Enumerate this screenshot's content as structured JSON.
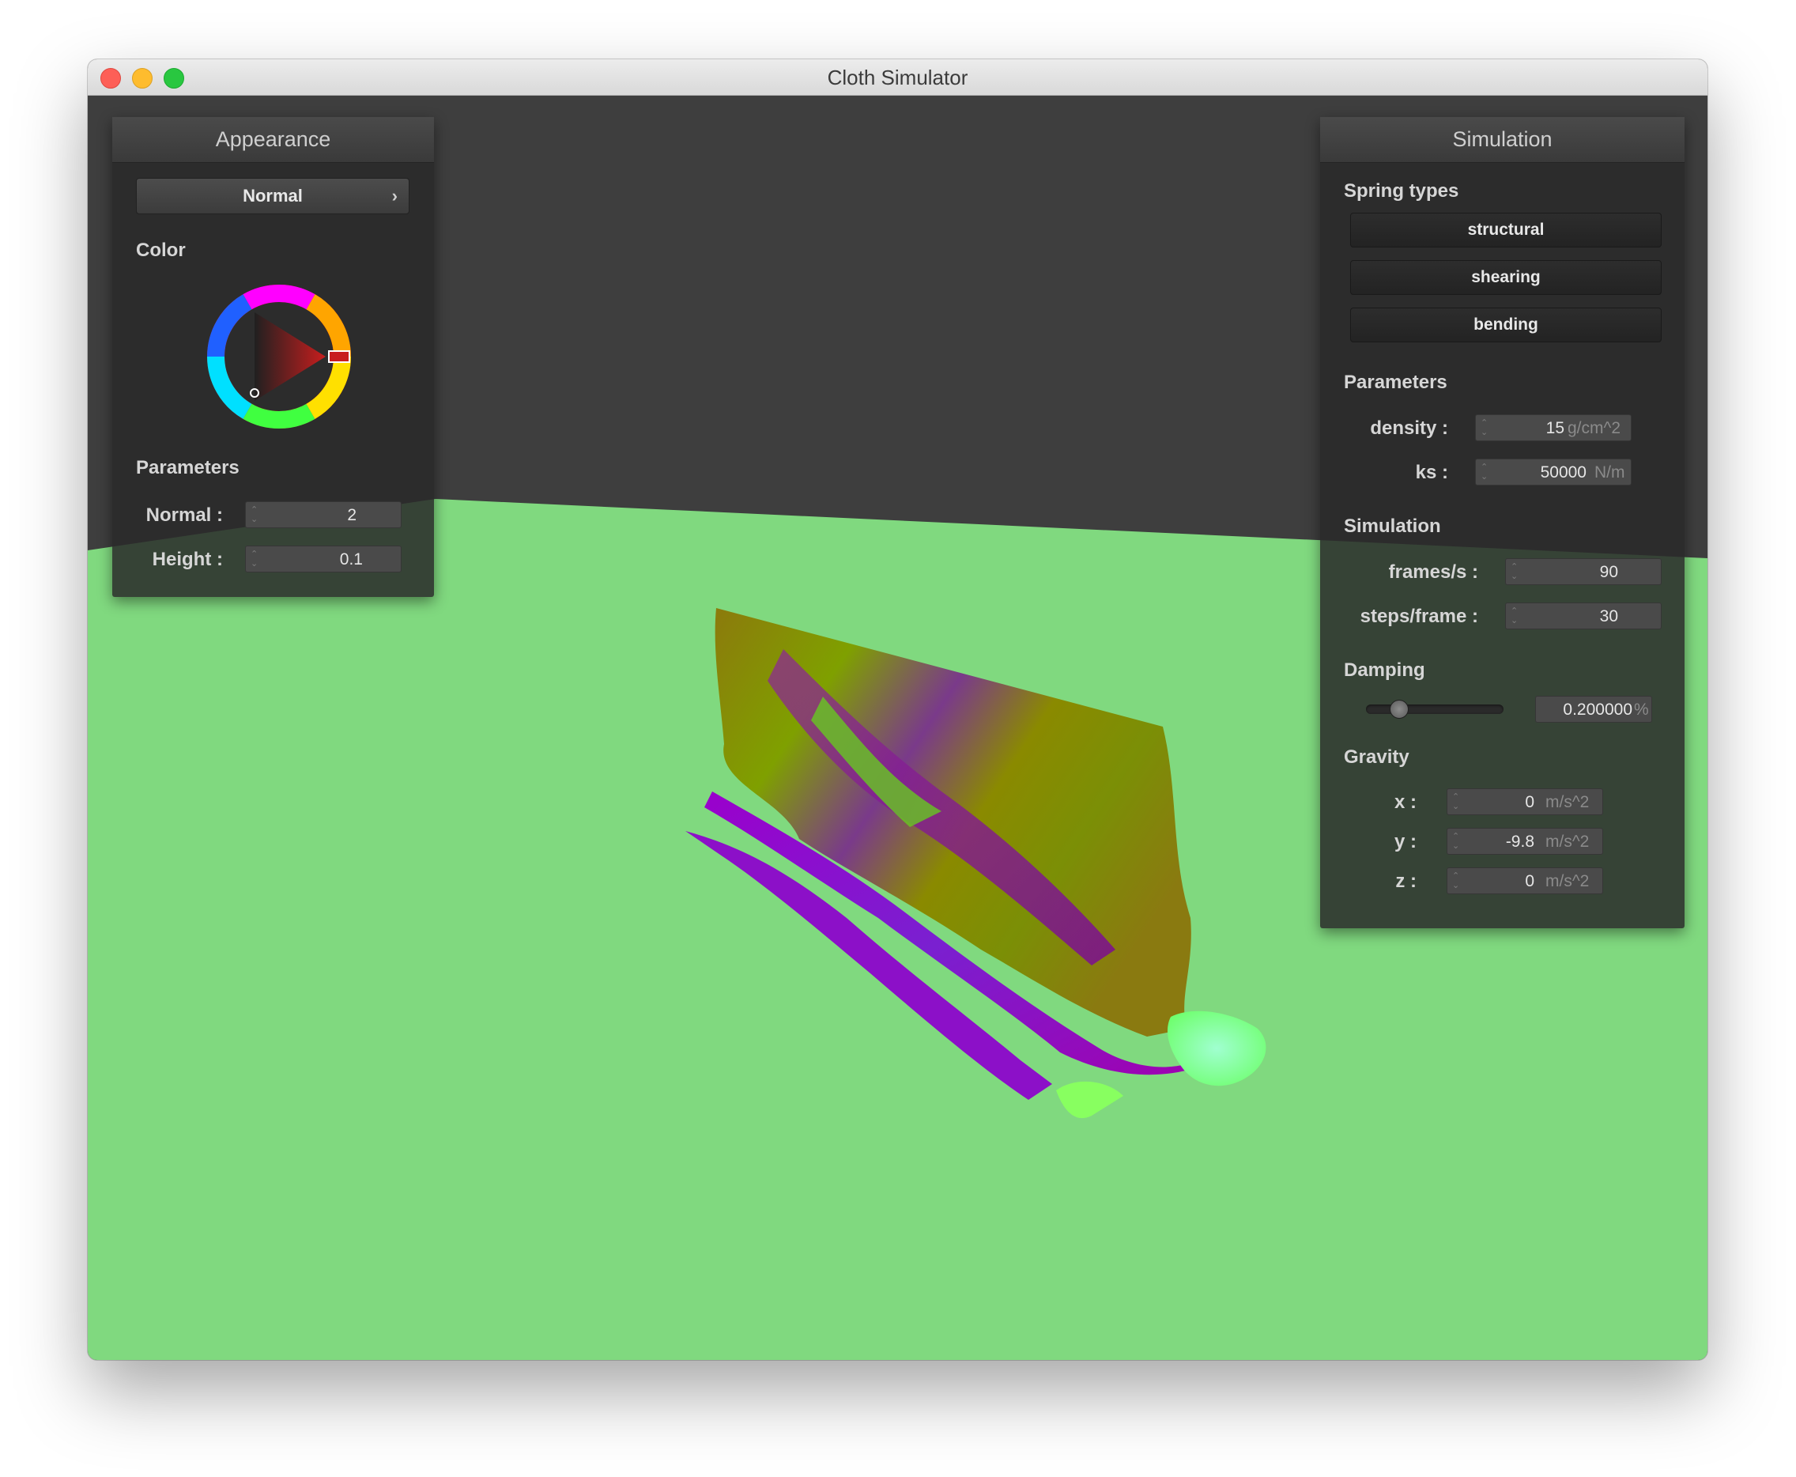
{
  "window": {
    "title": "Cloth Simulator"
  },
  "appearance": {
    "title": "Appearance",
    "shader": "Normal",
    "color_label": "Color",
    "color_value": "#c81e1e",
    "params_label": "Parameters",
    "params": [
      {
        "label": "Normal :",
        "value": "2"
      },
      {
        "label": "Height :",
        "value": "0.1"
      }
    ]
  },
  "simulation": {
    "title": "Simulation",
    "spring_types_label": "Spring types",
    "spring_buttons": [
      "structural",
      "shearing",
      "bending"
    ],
    "params_label": "Parameters",
    "params": [
      {
        "label": "density :",
        "value": "15",
        "unit": "g/cm^2"
      },
      {
        "label": "ks :",
        "value": "50000",
        "unit": "N/m"
      }
    ],
    "sim_label": "Simulation",
    "sim_params": [
      {
        "label": "frames/s :",
        "value": "90"
      },
      {
        "label": "steps/frame :",
        "value": "30"
      }
    ],
    "damping_label": "Damping",
    "damping": {
      "value": "0.200000",
      "unit": "%",
      "fraction": 0.2
    },
    "gravity_label": "Gravity",
    "gravity": [
      {
        "label": "x :",
        "value": "0",
        "unit": "m/s^2"
      },
      {
        "label": "y :",
        "value": "-9.8",
        "unit": "m/s^2"
      },
      {
        "label": "z :",
        "value": "0",
        "unit": "m/s^2"
      }
    ]
  },
  "scene": {
    "background_color": "#3e3e3e",
    "ground_color": "#80d97f",
    "cloth_colors": [
      "#7a8a00",
      "#8e3fa0",
      "#8b00d6",
      "#7cff66",
      "#9aff9a"
    ]
  }
}
